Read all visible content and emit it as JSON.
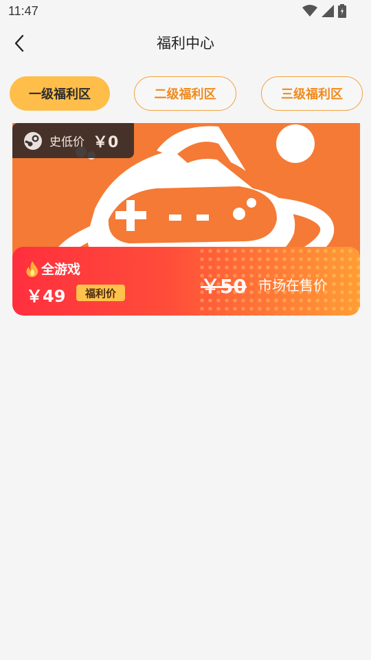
{
  "status_bar": {
    "time": "11:47"
  },
  "header": {
    "title": "福利中心"
  },
  "tabs": [
    {
      "label": "一级福利区",
      "active": true
    },
    {
      "label": "二级福利区",
      "active": false
    },
    {
      "label": "三级福利区",
      "active": false
    }
  ],
  "card": {
    "steam_badge": {
      "label": "史低价",
      "price": "￥0"
    },
    "game_label": "全游戏",
    "welfare_price": "￥49",
    "welfare_tag": "福利价",
    "market_price": "￥50",
    "market_label": "市场在售价"
  },
  "colors": {
    "accent": "#ffbe4a",
    "tab_text_inactive": "#f08a1c",
    "banner_orange": "#f47a35",
    "panel_red": "#ff2f3e",
    "panel_orange": "#ff9d35"
  },
  "icons": {
    "back": "chevron-left-icon",
    "wifi": "wifi-icon",
    "signal": "signal-icon",
    "battery": "battery-icon",
    "steam": "steam-icon",
    "fire": "fire-icon"
  }
}
